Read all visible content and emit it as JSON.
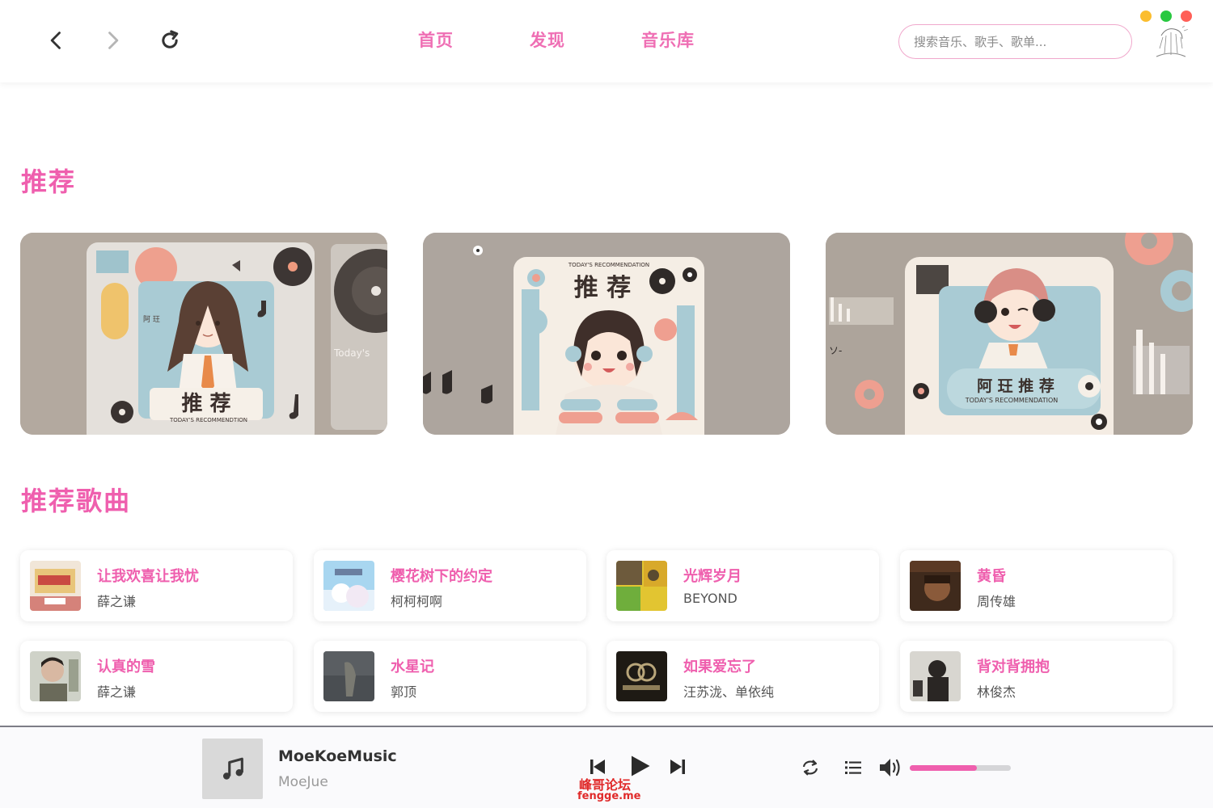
{
  "header": {
    "nav": {
      "home": "首页",
      "discover": "发现",
      "library": "音乐库"
    },
    "search": {
      "placeholder": "搜索音乐、歌手、歌单..."
    },
    "icons": {
      "back": "chevron-left-icon",
      "forward": "chevron-right-icon",
      "refresh": "refresh-icon"
    }
  },
  "window": {
    "controls": {
      "minimize_color": "#fbbd2e",
      "maximize_color": "#28c840",
      "close_color": "#ff5f57"
    }
  },
  "recommend": {
    "title": "推荐",
    "banners": [
      {
        "title": "推 荐",
        "subtitle": "TODAY'S RECOMMENDTION",
        "side_text": "Today's",
        "side_label": "阿 玨"
      },
      {
        "title": "推 荐",
        "subtitle": "TODAY'S RECOMMENDATION"
      },
      {
        "title": "阿 玨 推 荐",
        "subtitle": "TODAY'S RECOMMENDATION",
        "side_text": "ソ-"
      }
    ]
  },
  "songs": {
    "title": "推荐歌曲",
    "items": [
      {
        "title": "让我欢喜让我忧",
        "artist": "薛之谦"
      },
      {
        "title": "樱花树下的约定",
        "artist": "柯柯柯啊"
      },
      {
        "title": "光辉岁月",
        "artist": "BEYOND"
      },
      {
        "title": "黄昏",
        "artist": "周传雄"
      },
      {
        "title": "认真的雪",
        "artist": "薛之谦"
      },
      {
        "title": "水星记",
        "artist": "郭顶"
      },
      {
        "title": "如果爱忘了",
        "artist": "汪苏泷、单依纯"
      },
      {
        "title": "背对背拥抱",
        "artist": "林俊杰"
      }
    ]
  },
  "player": {
    "title": "MoeKoeMusic",
    "artist": "MoeJue",
    "volume": 0.66,
    "accent_color": "#ef5fae"
  },
  "watermark": {
    "line1": "峰哥论坛",
    "line2": "fengge.me"
  },
  "theme": {
    "accent": "#ef5fae",
    "search_border": "#f0a8cc"
  }
}
